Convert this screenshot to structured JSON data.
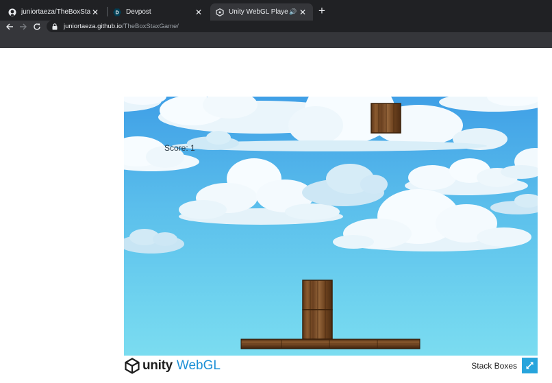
{
  "browser": {
    "tabs": [
      {
        "title": "juniortaeza/TheBoxStaxGame",
        "icon": "github-icon",
        "active": false
      },
      {
        "title": "Devpost",
        "icon": "devpost-icon",
        "active": false
      },
      {
        "title": "Unity WebGL Player | Stack B",
        "icon": "unity-icon",
        "active": true
      }
    ],
    "url_host": "juniortaeza.github.io",
    "url_path": "/TheBoxStaxGame/"
  },
  "game": {
    "score_label": "Score: 1",
    "engine_name": "unity",
    "engine_suffix": "WebGL",
    "title": "Stack Boxes"
  },
  "colors": {
    "chrome_dark": "#202124",
    "chrome_toolbar": "#35363a",
    "sky_top": "#3f9fe6",
    "sky_bottom": "#7bdcf0",
    "webgl_blue": "#1a8fd6",
    "fullscreen_blue": "#27a4dc"
  }
}
